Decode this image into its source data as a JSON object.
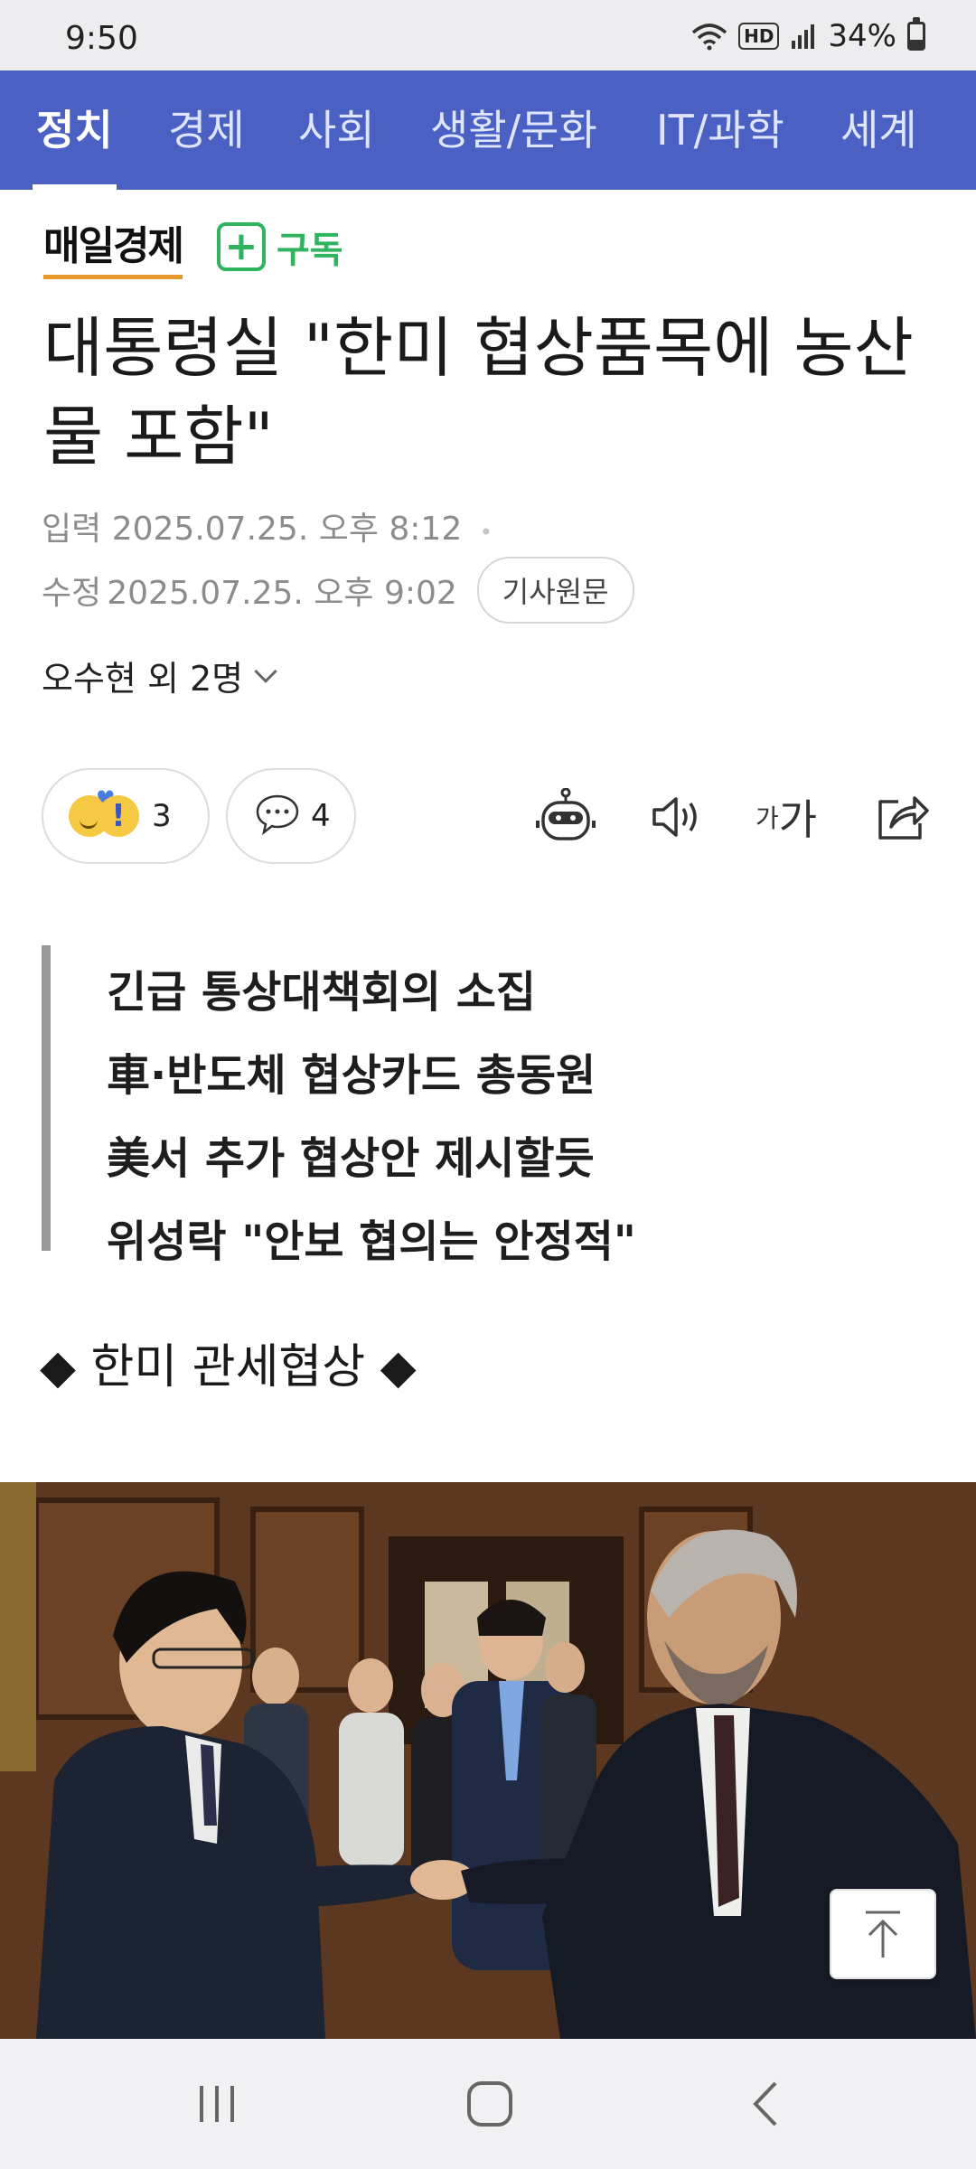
{
  "status_bar": {
    "time": "9:50",
    "battery": "34%",
    "battery_level": 0.34,
    "icons": [
      "wifi-icon",
      "hd-badge",
      "signal-icon",
      "battery-icon"
    ],
    "hd_label": "HD"
  },
  "categories": [
    {
      "label": "정치",
      "active": true
    },
    {
      "label": "경제",
      "active": false
    },
    {
      "label": "사회",
      "active": false
    },
    {
      "label": "생활/문화",
      "active": false
    },
    {
      "label": "IT/과학",
      "active": false
    },
    {
      "label": "세계",
      "active": false
    }
  ],
  "press": {
    "name": "매일경제",
    "subscribe_label": "구독",
    "subscribe_icon": "+"
  },
  "article": {
    "headline": "대통령실 \"한미 협상품목에 농산물 포함\"",
    "input_label": "입력",
    "input_time": "2025.07.25. 오후 8:12",
    "modified_label": "수정",
    "modified_time": "2025.07.25. 오후 9:02",
    "original_button": "기사원문",
    "author": "오수현 외 2명",
    "reactions_count": "3",
    "comments_count": "4",
    "font_tool_small": "가",
    "font_tool_large": "가",
    "summary": [
      "긴급 통상대책회의 소집",
      "車·반도체 협상카드 총동원",
      "美서 추가 협상안 제시할듯",
      "위성락 \"안보 협의는 안정적\""
    ],
    "section_tag": "◆ 한미 관세협상 ◆"
  },
  "colors": {
    "tab_bar": "#4a61c3",
    "subscribe_green": "#2fb35f",
    "logo_underline": "#e79a2a"
  }
}
